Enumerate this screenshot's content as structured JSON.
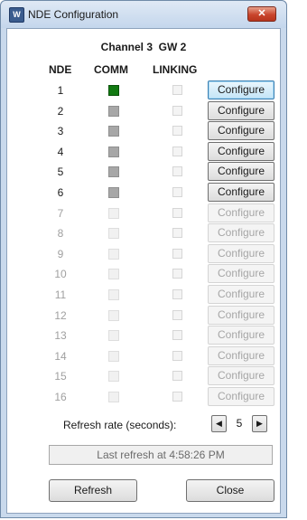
{
  "window": {
    "title": "NDE Configuration",
    "close_glyph": "✕",
    "app_icon": "app-logo-icon"
  },
  "channel_label": "Channel 3  GW 2",
  "headers": {
    "nde": "NDE",
    "comm": "COMM",
    "linking": "LINKING"
  },
  "rows": [
    {
      "nde": "1",
      "comm": "green",
      "enabled": true,
      "focused": true,
      "button": "Configure"
    },
    {
      "nde": "2",
      "comm": "gray",
      "enabled": true,
      "focused": false,
      "button": "Configure"
    },
    {
      "nde": "3",
      "comm": "gray",
      "enabled": true,
      "focused": false,
      "button": "Configure"
    },
    {
      "nde": "4",
      "comm": "gray",
      "enabled": true,
      "focused": false,
      "button": "Configure"
    },
    {
      "nde": "5",
      "comm": "gray",
      "enabled": true,
      "focused": false,
      "button": "Configure"
    },
    {
      "nde": "6",
      "comm": "gray",
      "enabled": true,
      "focused": false,
      "button": "Configure"
    },
    {
      "nde": "7",
      "comm": "disabled",
      "enabled": false,
      "focused": false,
      "button": "Configure"
    },
    {
      "nde": "8",
      "comm": "disabled",
      "enabled": false,
      "focused": false,
      "button": "Configure"
    },
    {
      "nde": "9",
      "comm": "disabled",
      "enabled": false,
      "focused": false,
      "button": "Configure"
    },
    {
      "nde": "10",
      "comm": "disabled",
      "enabled": false,
      "focused": false,
      "button": "Configure"
    },
    {
      "nde": "11",
      "comm": "disabled",
      "enabled": false,
      "focused": false,
      "button": "Configure"
    },
    {
      "nde": "12",
      "comm": "disabled",
      "enabled": false,
      "focused": false,
      "button": "Configure"
    },
    {
      "nde": "13",
      "comm": "disabled",
      "enabled": false,
      "focused": false,
      "button": "Configure"
    },
    {
      "nde": "14",
      "comm": "disabled",
      "enabled": false,
      "focused": false,
      "button": "Configure"
    },
    {
      "nde": "15",
      "comm": "disabled",
      "enabled": false,
      "focused": false,
      "button": "Configure"
    },
    {
      "nde": "16",
      "comm": "disabled",
      "enabled": false,
      "focused": false,
      "button": "Configure"
    }
  ],
  "refresh": {
    "label": "Refresh rate (seconds):",
    "value": "5",
    "decrement_icon": "◀",
    "increment_icon": "▶"
  },
  "last_refresh_text": "Last refresh at 4:58:26 PM",
  "buttons": {
    "refresh": "Refresh",
    "close": "Close"
  }
}
